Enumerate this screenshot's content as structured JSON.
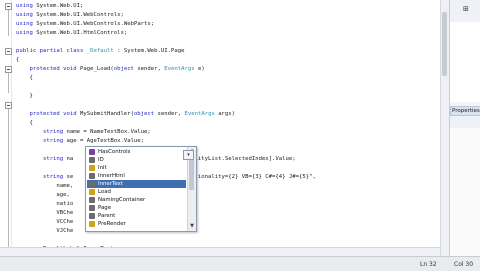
{
  "code_lines": [
    {
      "text": "using System.Web.UI;",
      "kind": "using"
    },
    {
      "text": "using System.Web.UI.WebControls;",
      "kind": "using"
    },
    {
      "text": "using System.Web.UI.WebControls.WebParts;",
      "kind": "using"
    },
    {
      "text": "using System.Web.UI.HtmlControls;",
      "kind": "using"
    },
    {
      "text": "",
      "kind": "blank"
    },
    {
      "text": "public partial class _Default : System.Web.UI.Page",
      "kind": "class"
    },
    {
      "text": "{",
      "kind": "plain"
    },
    {
      "text": "    protected void Page_Load(object sender, EventArgs e)",
      "kind": "method"
    },
    {
      "text": "    {",
      "kind": "plain"
    },
    {
      "text": "",
      "kind": "blank"
    },
    {
      "text": "    }",
      "kind": "plain"
    },
    {
      "text": "",
      "kind": "blank"
    },
    {
      "text": "    protected void MySubmitHandler(object sender, EventArgs args)",
      "kind": "method"
    },
    {
      "text": "    {",
      "kind": "plain"
    },
    {
      "text": "        string name = NameTextBox.Value;",
      "kind": "plain"
    },
    {
      "text": "        string age = AgeTextBox.Value;",
      "kind": "plain"
    },
    {
      "text": "",
      "kind": "blank"
    },
    {
      "text": "        string na                       Items[NationalityList.SelectedIndex].Value;",
      "kind": "plain"
    },
    {
      "text": "",
      "kind": "blank"
    },
    {
      "text": "        string se                       0} Age={1} Nationality={2} VB={3} C#={4} J#={5}\",",
      "kind": "plain"
    },
    {
      "text": "            name,",
      "kind": "plain"
    },
    {
      "text": "            age,",
      "kind": "plain"
    },
    {
      "text": "            natio",
      "kind": "plain"
    },
    {
      "text": "            VBChe",
      "kind": "plain"
    },
    {
      "text": "            VCChe",
      "kind": "plain"
    },
    {
      "text": "            VJChe",
      "kind": "plain"
    },
    {
      "text": "",
      "kind": "blank"
    },
    {
      "text": "        ResultLabel.InnerText",
      "kind": "plain"
    },
    {
      "text": "    }",
      "kind": "plain"
    }
  ],
  "intellisense": {
    "items": [
      {
        "label": "HasControls",
        "icon": "method-icon",
        "color": "#7b3fa6"
      },
      {
        "label": "ID",
        "icon": "property-icon",
        "color": "#6b6b6b"
      },
      {
        "label": "Init",
        "icon": "event-icon",
        "color": "#d4a017"
      },
      {
        "label": "InnerHtml",
        "icon": "property-icon",
        "color": "#6b6b6b"
      },
      {
        "label": "InnerText",
        "icon": "property-icon",
        "color": "#6b6b6b"
      },
      {
        "label": "Load",
        "icon": "event-icon",
        "color": "#d4a017"
      },
      {
        "label": "NamingContainer",
        "icon": "property-icon",
        "color": "#6b6b6b"
      },
      {
        "label": "Page",
        "icon": "property-icon",
        "color": "#6b6b6b"
      },
      {
        "label": "Parent",
        "icon": "property-icon",
        "color": "#6b6b6b"
      },
      {
        "label": "PreRender",
        "icon": "event-icon",
        "color": "#d4a017"
      }
    ],
    "selected_index": 4
  },
  "properties_panel": {
    "title": "Properties"
  },
  "status": {
    "line": "Ln 32",
    "col": "Col 30"
  },
  "colors": {
    "keyword": "#1d1dc8",
    "type": "#2b91af",
    "selection": "#3f6fb0"
  }
}
